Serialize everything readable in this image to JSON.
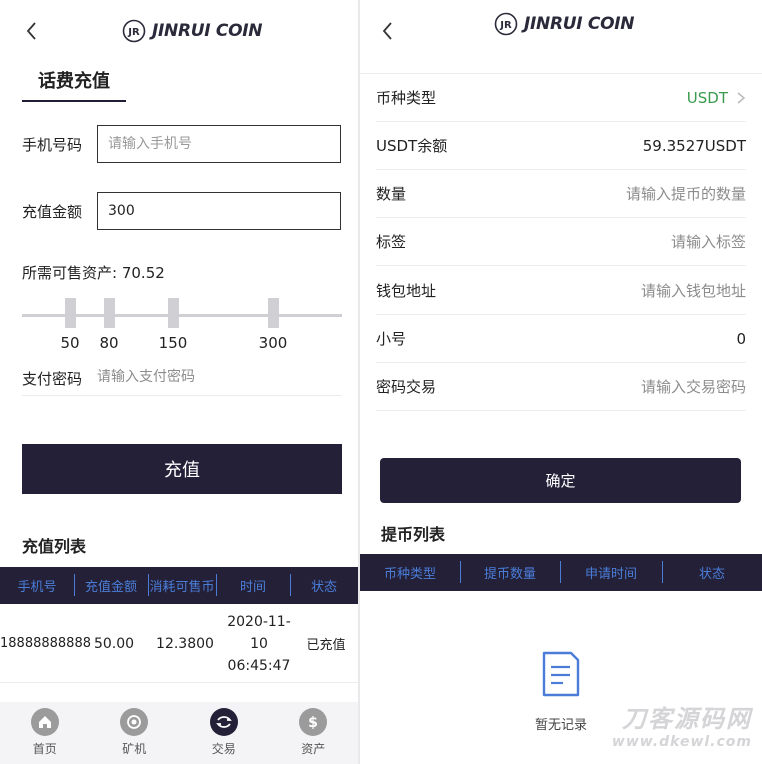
{
  "brand": {
    "name": "JINRUI COIN"
  },
  "left": {
    "tab_title": "话费充值",
    "phone": {
      "label": "手机号码",
      "placeholder": "请输入手机号",
      "value": ""
    },
    "amount": {
      "label": "充值金额",
      "value": "300"
    },
    "asset": {
      "label": "所需可售资产:",
      "value": "70.52"
    },
    "slider_options": [
      "50",
      "80",
      "150",
      "300"
    ],
    "pay_password": {
      "label": "支付密码",
      "placeholder": "请输入支付密码"
    },
    "charge_button": "充值",
    "list_title": "充值列表",
    "table": {
      "headers": [
        "手机号",
        "充值金额",
        "消耗可售币",
        "时间",
        "状态"
      ],
      "rows": [
        {
          "phone": "18888888888",
          "amount": "50.00",
          "consumed": "12.3800",
          "date": "2020-11-10",
          "time": "06:45:47",
          "status": "已充值"
        }
      ]
    },
    "tabbar": [
      {
        "label": "首页",
        "icon": "home-icon"
      },
      {
        "label": "矿机",
        "icon": "miner-icon"
      },
      {
        "label": "交易",
        "icon": "trade-icon",
        "active": true
      },
      {
        "label": "资产",
        "icon": "asset-icon"
      }
    ]
  },
  "right": {
    "form": {
      "coin_type": {
        "label": "币种类型",
        "value": "USDT"
      },
      "balance": {
        "label": "USDT余额",
        "value": "59.3527USDT"
      },
      "quantity": {
        "label": "数量",
        "placeholder": "请输入提币的数量"
      },
      "tag": {
        "label": "标签",
        "placeholder": "请输入标签"
      },
      "wallet": {
        "label": "钱包地址",
        "placeholder": "请输入钱包地址"
      },
      "fee": {
        "label": "小号",
        "value": "0"
      },
      "trade_password": {
        "label": "密码交易",
        "placeholder": "请输入交易密码"
      }
    },
    "confirm_button": "确定",
    "list_title": "提币列表",
    "table_headers": [
      "币种类型",
      "提币数量",
      "申请时间",
      "状态"
    ],
    "empty_text": "暂无记录",
    "watermark": {
      "line1": "刀客源码网",
      "line2": "www.dkewl.com"
    }
  },
  "colors": {
    "primary": "#232038",
    "header_text": "#4b7dd8",
    "coin_value": "#3a9a4e"
  }
}
